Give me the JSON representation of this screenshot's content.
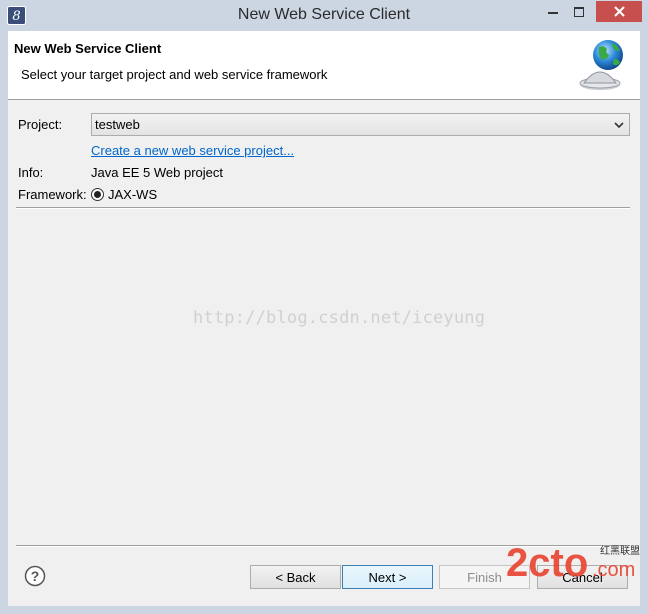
{
  "window": {
    "title": "New Web Service Client"
  },
  "banner": {
    "title": "New Web Service Client",
    "description": "Select your target project and web service framework"
  },
  "form": {
    "project_label": "Project:",
    "project_value": "testweb",
    "create_link": "Create a new web service project...",
    "info_label": "Info:",
    "info_value": "Java EE 5 Web project",
    "framework_label": "Framework:",
    "framework_option": "JAX-WS"
  },
  "watermark": "http://blog.csdn.net/iceyung",
  "buttons": {
    "back": "< Back",
    "next": "Next >",
    "finish": "Finish",
    "cancel": "Cancel"
  },
  "logo": {
    "main": "2cto",
    "suffix": ".com",
    "caption": "红黑联盟"
  },
  "icons": [
    "eclipse-app-icon",
    "minimize-icon",
    "maximize-icon",
    "close-icon",
    "globe-server-icon",
    "chevron-down-icon",
    "help-icon"
  ],
  "colors": {
    "titlebar": "#ccd6e2",
    "close": "#c7504e",
    "link": "#0066cc",
    "dialog": "#f0f0f0"
  }
}
